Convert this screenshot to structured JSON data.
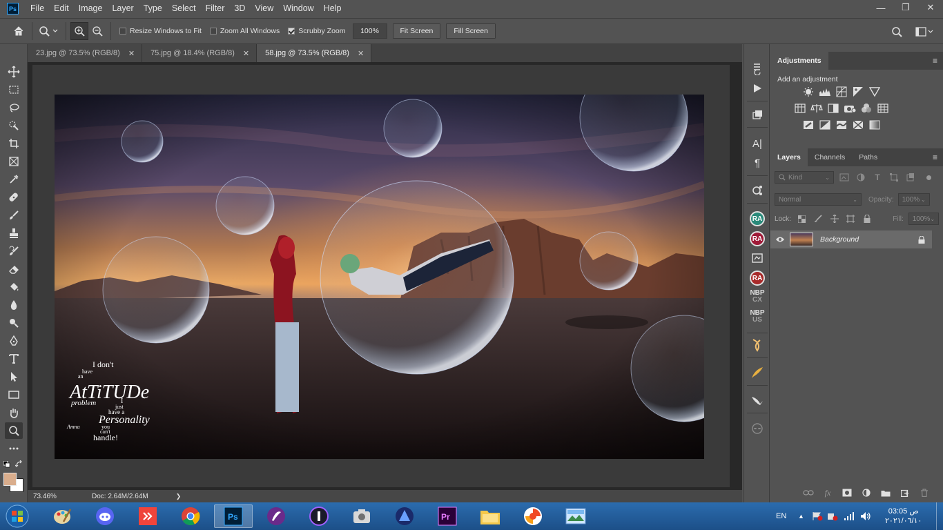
{
  "app": {
    "logo_text": "Ps"
  },
  "menu": [
    "File",
    "Edit",
    "Image",
    "Layer",
    "Type",
    "Select",
    "Filter",
    "3D",
    "View",
    "Window",
    "Help"
  ],
  "window_controls": {
    "minimize": "—",
    "restore": "❐",
    "close": "✕"
  },
  "options": {
    "resize_windows_label": "Resize Windows to Fit",
    "resize_windows_checked": false,
    "zoom_all_label": "Zoom All Windows",
    "zoom_all_checked": false,
    "scrubby_label": "Scrubby Zoom",
    "scrubby_checked": true,
    "zoom_value": "100%",
    "fit_screen_label": "Fit Screen",
    "fill_screen_label": "Fill Screen"
  },
  "tabs": [
    {
      "label": "23.jpg @ 73.5% (RGB/8)",
      "active": false
    },
    {
      "label": "75.jpg @ 18.4% (RGB/8)",
      "active": false
    },
    {
      "label": "58.jpg @ 73.5% (RGB/8)",
      "active": true
    }
  ],
  "status": {
    "zoom": "73.46%",
    "doc": "Doc: 2.64M/2.64M",
    "arrow": "❯"
  },
  "artwork_text": {
    "line1": "I don't",
    "line2": "have",
    "line3": "an",
    "line4": "AtTiTUDe",
    "line5": "problem",
    "line6": "I",
    "line7": "just",
    "line8": "have a",
    "line9": "Personality",
    "line10": "you",
    "line11": "can't",
    "line12": "handle!",
    "signature": "Amna"
  },
  "dock": {
    "ra1": "RA",
    "ra2": "RA",
    "ra3": "RA",
    "nbp1_top": "NBP",
    "nbp1_bottom": "CX",
    "nbp2_top": "NBP",
    "nbp2_bottom": "US"
  },
  "adjustments": {
    "title": "Adjustments",
    "subtitle": "Add an adjustment"
  },
  "layers_panel": {
    "tabs": [
      "Layers",
      "Channels",
      "Paths"
    ],
    "kind_placeholder": "Kind",
    "blend_mode": "Normal",
    "opacity_label": "Opacity:",
    "opacity_value": "100%",
    "lock_label": "Lock:",
    "fill_label": "Fill:",
    "fill_value": "100%",
    "layers": [
      {
        "name": "Background",
        "visible": true,
        "locked": true
      }
    ]
  },
  "taskbar": {
    "apps": [
      "paint",
      "discord",
      "anydesk",
      "chrome",
      "photoshop",
      "app-purple",
      "app-one",
      "camera",
      "app-triangle",
      "premiere",
      "file-explorer",
      "security",
      "image-viewer"
    ],
    "active_app": "photoshop",
    "lang": "EN",
    "time": "03:05 ص",
    "date": "٢٠٢١/٠٦/١٠"
  }
}
